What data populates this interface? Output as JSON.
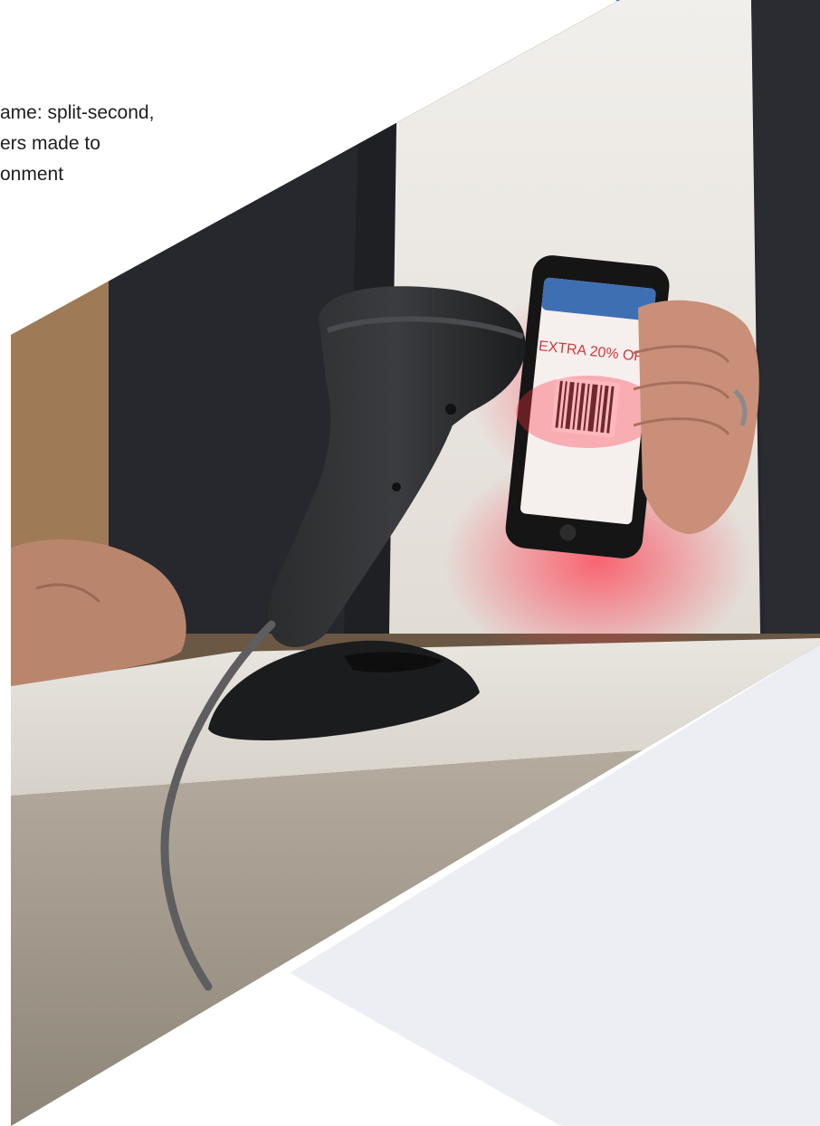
{
  "intro": {
    "lines": [
      "ame: split-second,",
      "ers made to",
      "onment"
    ]
  },
  "phone_screen": {
    "headline": "EXTRA 20% OFF"
  },
  "colors": {
    "accent_blue": "#1a6fe8",
    "panel_gray": "#eceef3",
    "background": "#ffffff"
  }
}
